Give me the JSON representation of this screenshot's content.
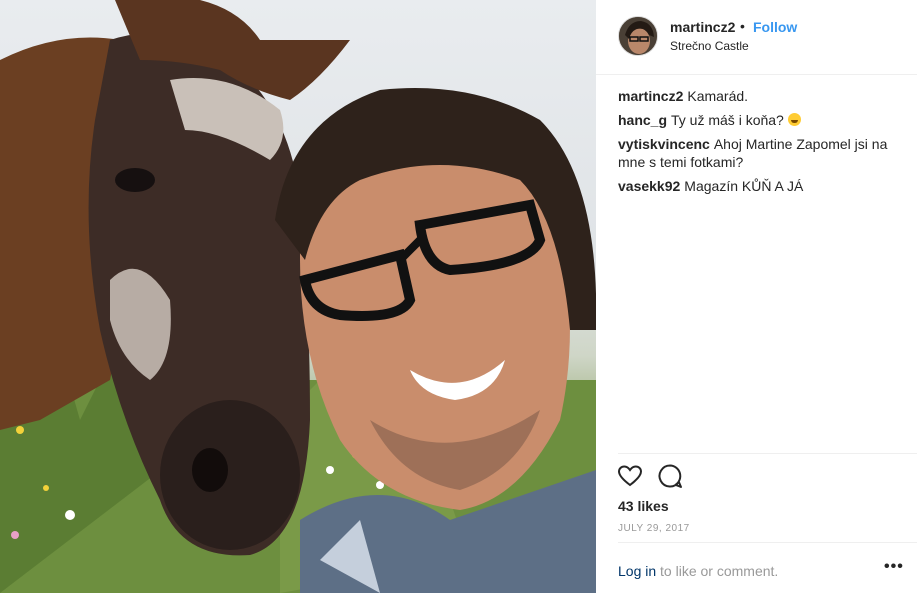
{
  "post": {
    "username": "martincz2",
    "separator": "•",
    "follow_label": "Follow",
    "location": "Strečno Castle"
  },
  "comments": [
    {
      "user": "martincz2",
      "text": "Kamarád."
    },
    {
      "user": "hanc_g",
      "text": "Ty už máš i koňa?",
      "emoji": "grinning-emoji"
    },
    {
      "user": "vytiskvincenc",
      "text": "Ahoj Martine Zapomel jsi na mne s temi fotkami?"
    },
    {
      "user": "vasekk92",
      "text": "Magazín KŮŇ A JÁ"
    }
  ],
  "actions": {
    "like_icon": "heart-icon",
    "comment_icon": "comment-bubble-icon"
  },
  "likes": "43 likes",
  "date": "JULY 29, 2017",
  "footer": {
    "login_link": "Log in",
    "login_rest": " to like or comment.",
    "more_label": "•••"
  },
  "colors": {
    "link_blue": "#3897f0",
    "login_blue": "#003569",
    "muted": "#999999",
    "text": "#262626"
  }
}
